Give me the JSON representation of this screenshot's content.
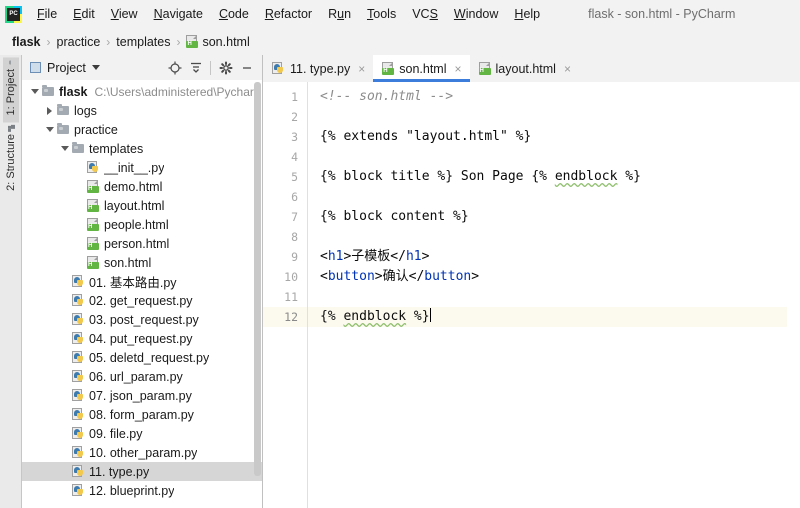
{
  "window": {
    "title": "flask - son.html - PyCharm",
    "app_icon": "pycharm-logo-icon"
  },
  "menu": {
    "items": [
      {
        "label": "File",
        "mnemonic": "F"
      },
      {
        "label": "Edit",
        "mnemonic": "E"
      },
      {
        "label": "View",
        "mnemonic": "V"
      },
      {
        "label": "Navigate",
        "mnemonic": "N"
      },
      {
        "label": "Code",
        "mnemonic": "C"
      },
      {
        "label": "Refactor",
        "mnemonic": "R"
      },
      {
        "label": "Run",
        "mnemonic": "u"
      },
      {
        "label": "Tools",
        "mnemonic": "T"
      },
      {
        "label": "VCS",
        "mnemonic": "S"
      },
      {
        "label": "Window",
        "mnemonic": "W"
      },
      {
        "label": "Help",
        "mnemonic": "H"
      }
    ]
  },
  "breadcrumb": {
    "separator": "›",
    "items": [
      {
        "label": "flask",
        "bold": true,
        "icon": null
      },
      {
        "label": "practice",
        "bold": false,
        "icon": null
      },
      {
        "label": "templates",
        "bold": false,
        "icon": null
      },
      {
        "label": "son.html",
        "bold": false,
        "icon": "html-file-icon"
      }
    ]
  },
  "toolwindow_bar": {
    "tabs": [
      {
        "label": "1: Project",
        "icon": "folder-icon",
        "active": true
      },
      {
        "label": "2: Structure",
        "icon": "structure-icon",
        "active": false
      }
    ]
  },
  "project_panel": {
    "title": "Project",
    "dropdown_icon": "chevron-down-icon",
    "tools": [
      {
        "name": "locate-icon",
        "glyph": "⊕"
      },
      {
        "name": "collapse-all-icon",
        "glyph": "≡"
      },
      {
        "name": "settings-gear-icon",
        "glyph": "⚙"
      },
      {
        "name": "hide-panel-icon",
        "glyph": "−"
      }
    ],
    "tree": [
      {
        "label": "flask",
        "path": "C:\\Users\\administered\\Pychar",
        "icon": "folder-icon",
        "indent": 0,
        "twisty": "down",
        "bold": true,
        "selected": false
      },
      {
        "label": "logs",
        "icon": "folder-icon",
        "indent": 1,
        "twisty": "right",
        "bold": false,
        "selected": false
      },
      {
        "label": "practice",
        "icon": "folder-icon",
        "indent": 1,
        "twisty": "down",
        "bold": false,
        "selected": false
      },
      {
        "label": "templates",
        "icon": "folder-icon",
        "indent": 2,
        "twisty": "down",
        "bold": false,
        "selected": false
      },
      {
        "label": "__init__.py",
        "icon": "python-file-icon",
        "indent": 3,
        "twisty": "none",
        "bold": false,
        "selected": false
      },
      {
        "label": "demo.html",
        "icon": "html-file-icon",
        "indent": 3,
        "twisty": "none",
        "bold": false,
        "selected": false
      },
      {
        "label": "layout.html",
        "icon": "html-file-icon",
        "indent": 3,
        "twisty": "none",
        "bold": false,
        "selected": false
      },
      {
        "label": "people.html",
        "icon": "html-file-icon",
        "indent": 3,
        "twisty": "none",
        "bold": false,
        "selected": false
      },
      {
        "label": "person.html",
        "icon": "html-file-icon",
        "indent": 3,
        "twisty": "none",
        "bold": false,
        "selected": false
      },
      {
        "label": "son.html",
        "icon": "html-file-icon",
        "indent": 3,
        "twisty": "none",
        "bold": false,
        "selected": false
      },
      {
        "label": "01. 基本路由.py",
        "icon": "python-file-icon",
        "indent": 2,
        "twisty": "none",
        "bold": false,
        "selected": false
      },
      {
        "label": "02. get_request.py",
        "icon": "python-file-icon",
        "indent": 2,
        "twisty": "none",
        "bold": false,
        "selected": false
      },
      {
        "label": "03. post_request.py",
        "icon": "python-file-icon",
        "indent": 2,
        "twisty": "none",
        "bold": false,
        "selected": false
      },
      {
        "label": "04. put_request.py",
        "icon": "python-file-icon",
        "indent": 2,
        "twisty": "none",
        "bold": false,
        "selected": false
      },
      {
        "label": "05. deletd_request.py",
        "icon": "python-file-icon",
        "indent": 2,
        "twisty": "none",
        "bold": false,
        "selected": false
      },
      {
        "label": "06. url_param.py",
        "icon": "python-file-icon",
        "indent": 2,
        "twisty": "none",
        "bold": false,
        "selected": false
      },
      {
        "label": "07. json_param.py",
        "icon": "python-file-icon",
        "indent": 2,
        "twisty": "none",
        "bold": false,
        "selected": false
      },
      {
        "label": "08. form_param.py",
        "icon": "python-file-icon",
        "indent": 2,
        "twisty": "none",
        "bold": false,
        "selected": false
      },
      {
        "label": "09. file.py",
        "icon": "python-file-icon",
        "indent": 2,
        "twisty": "none",
        "bold": false,
        "selected": false
      },
      {
        "label": "10. other_param.py",
        "icon": "python-file-icon",
        "indent": 2,
        "twisty": "none",
        "bold": false,
        "selected": false
      },
      {
        "label": "11. type.py",
        "icon": "python-file-icon",
        "indent": 2,
        "twisty": "none",
        "bold": false,
        "selected": true
      },
      {
        "label": "12. blueprint.py",
        "icon": "python-file-icon",
        "indent": 2,
        "twisty": "none",
        "bold": false,
        "selected": false
      }
    ]
  },
  "editor": {
    "tabs": [
      {
        "label": "11. type.py",
        "icon": "python-file-icon",
        "active": false,
        "close_glyph": "×"
      },
      {
        "label": "son.html",
        "icon": "html-file-icon",
        "active": true,
        "close_glyph": "×"
      },
      {
        "label": "layout.html",
        "icon": "html-file-icon",
        "active": false,
        "close_glyph": "×"
      }
    ],
    "active_tab_underline_color": "#3c7ddb",
    "current_line": 12,
    "lines": [
      {
        "n": 1,
        "segments": [
          {
            "t": "<!-- son.html -->",
            "c": "cmt"
          }
        ]
      },
      {
        "n": 2,
        "segments": []
      },
      {
        "n": 3,
        "segments": [
          {
            "t": "{% extends \"layout.html\" %}",
            "c": "str"
          }
        ]
      },
      {
        "n": 4,
        "segments": []
      },
      {
        "n": 5,
        "segments": [
          {
            "t": "{% block title %} Son Page {% ",
            "c": "str"
          },
          {
            "t": "endblock",
            "c": "sq"
          },
          {
            "t": " %}",
            "c": "str"
          }
        ]
      },
      {
        "n": 6,
        "segments": []
      },
      {
        "n": 7,
        "segments": [
          {
            "t": "{% block content %}",
            "c": "str"
          }
        ]
      },
      {
        "n": 8,
        "segments": []
      },
      {
        "n": 9,
        "segments": [
          {
            "t": "<",
            "c": "str"
          },
          {
            "t": "h1",
            "c": "tag"
          },
          {
            "t": ">子模板</",
            "c": "str"
          },
          {
            "t": "h1",
            "c": "tag"
          },
          {
            "t": ">",
            "c": "str"
          }
        ]
      },
      {
        "n": 10,
        "segments": [
          {
            "t": "<",
            "c": "str"
          },
          {
            "t": "button",
            "c": "tag"
          },
          {
            "t": ">确认</",
            "c": "str"
          },
          {
            "t": "button",
            "c": "tag"
          },
          {
            "t": ">",
            "c": "str"
          }
        ]
      },
      {
        "n": 11,
        "segments": []
      },
      {
        "n": 12,
        "segments": [
          {
            "t": "{% ",
            "c": "str"
          },
          {
            "t": "endblock",
            "c": "sq"
          },
          {
            "t": " %}",
            "c": "str"
          }
        ],
        "caret": true
      }
    ]
  },
  "colors": {
    "accent_blue": "#3c7ddb",
    "tag_blue": "#0033b3",
    "comment_gray": "#8c8c8c",
    "html_icon_green": "#62b543",
    "current_line_bg": "#fcfaef",
    "selection_gray": "#d6d6d6"
  }
}
